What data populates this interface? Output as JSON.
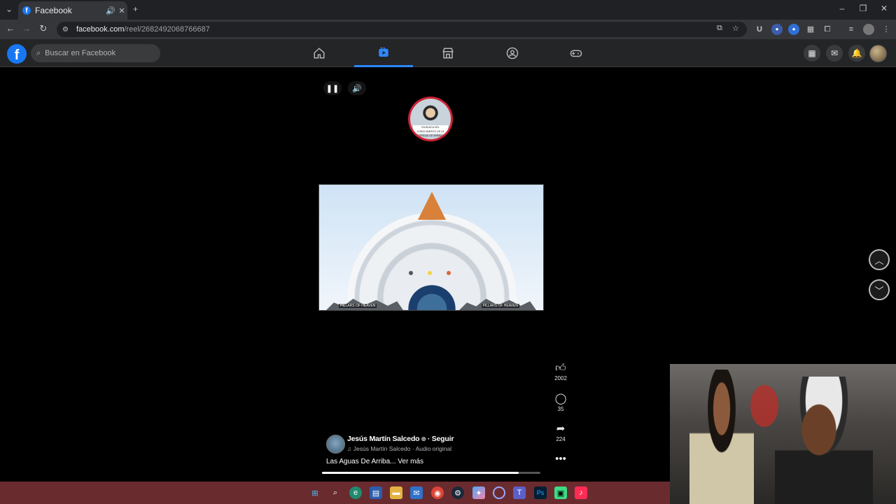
{
  "browser": {
    "tab_title": "Facebook",
    "tab_favicon": "f",
    "url_host": "facebook.com",
    "url_path": "/reel/2682492068766687"
  },
  "facebook": {
    "logo": "f",
    "search_placeholder": "Buscar en Facebook",
    "nav_tabs": [
      "home-icon",
      "reels-icon",
      "marketplace-icon",
      "groups-icon",
      "gaming-icon"
    ],
    "active_tab": "reels-icon",
    "colors": {
      "brand": "#1877f2",
      "active": "#2d88ff",
      "bar": "#242526"
    }
  },
  "reel": {
    "profile_banner_text": "EN BUSCA DEL CONOCIMIENTO DE LA VERDAD DE ARRIBA",
    "video_label_left": "PILLARS OF HEAVEN",
    "video_label_right": "PILLARS OF HEAVEN",
    "likes": "2002",
    "comments": "35",
    "shares": "224",
    "author_name": "Jesús Martín Salcedo",
    "follow_label": "Seguir",
    "audio_text": "Jesús Martín Salcedo · Audio original",
    "caption": "Las Aguas De Arriba...",
    "see_more": "Ver más",
    "progress_fraction": 0.9
  },
  "taskbar": {
    "icons": [
      "windows-start-icon",
      "search-icon",
      "edge-icon",
      "store-icon",
      "file-explorer-icon",
      "mail-icon",
      "chrome-icon",
      "steam-icon",
      "copilot-icon",
      "app-icon",
      "teams-icon",
      "photoshop-icon",
      "app-green-icon",
      "tiktok-icon"
    ],
    "color": "#6a2b2f"
  }
}
